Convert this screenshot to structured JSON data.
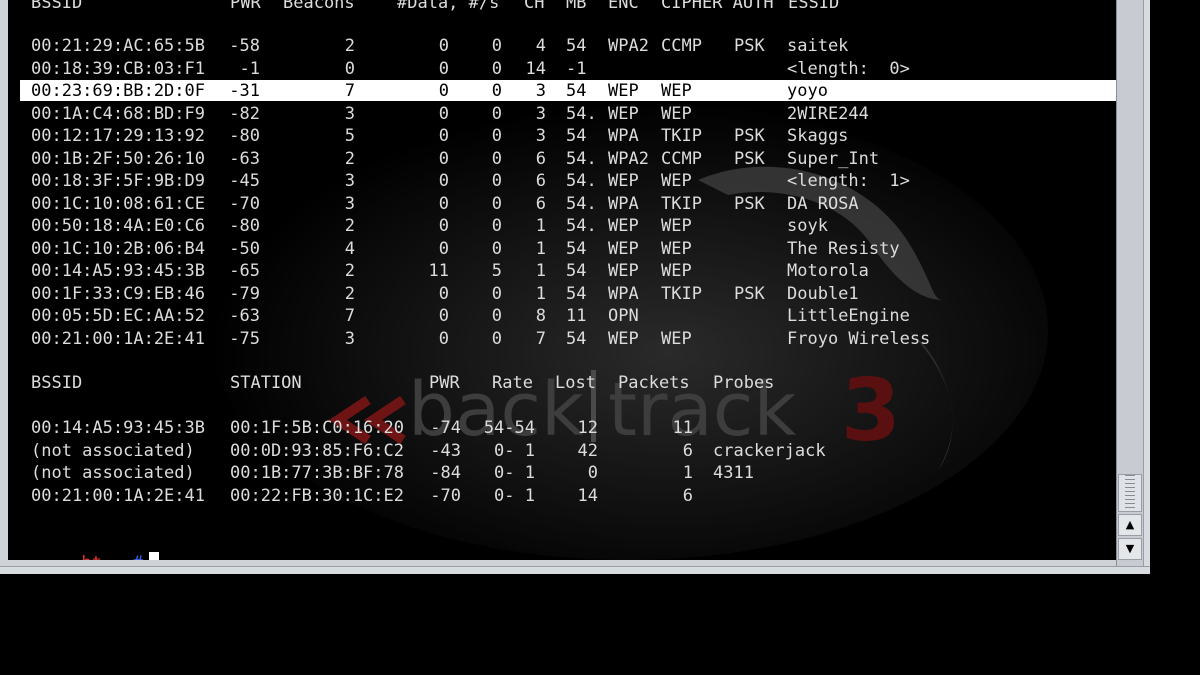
{
  "ap_headers": [
    "BSSID",
    "PWR",
    "Beacons",
    "#Data, #/s",
    "CH",
    "MB",
    "ENC",
    "CIPHER AUTH",
    "ESSID"
  ],
  "ap_rows": [
    {
      "bssid": "00:21:29:AC:65:5B",
      "pwr": "-58",
      "beacons": "2",
      "data": "0",
      "rate": "0",
      "ch": "4",
      "mb": "54",
      "enc": "WPA2",
      "cipher": "CCMP",
      "auth": "PSK",
      "essid": "saitek"
    },
    {
      "bssid": "00:18:39:CB:03:F1",
      "pwr": "-1",
      "beacons": "0",
      "data": "0",
      "rate": "0",
      "ch": "14",
      "mb": "-1",
      "enc": "",
      "cipher": "",
      "auth": "",
      "essid": "<length:  0>"
    },
    {
      "bssid": "00:23:69:BB:2D:0F",
      "pwr": "-31",
      "beacons": "7",
      "data": "0",
      "rate": "0",
      "ch": "3",
      "mb": "54",
      "enc": "WEP",
      "cipher": "WEP",
      "auth": "",
      "essid": "yoyo",
      "selected": true
    },
    {
      "bssid": "00:1A:C4:68:BD:F9",
      "pwr": "-82",
      "beacons": "3",
      "data": "0",
      "rate": "0",
      "ch": "3",
      "mb": "54.",
      "enc": "WEP",
      "cipher": "WEP",
      "auth": "",
      "essid": "2WIRE244"
    },
    {
      "bssid": "00:12:17:29:13:92",
      "pwr": "-80",
      "beacons": "5",
      "data": "0",
      "rate": "0",
      "ch": "3",
      "mb": "54",
      "enc": "WPA",
      "cipher": "TKIP",
      "auth": "PSK",
      "essid": "Skaggs"
    },
    {
      "bssid": "00:1B:2F:50:26:10",
      "pwr": "-63",
      "beacons": "2",
      "data": "0",
      "rate": "0",
      "ch": "6",
      "mb": "54.",
      "enc": "WPA2",
      "cipher": "CCMP",
      "auth": "PSK",
      "essid": "Super_Int"
    },
    {
      "bssid": "00:18:3F:5F:9B:D9",
      "pwr": "-45",
      "beacons": "3",
      "data": "0",
      "rate": "0",
      "ch": "6",
      "mb": "54.",
      "enc": "WEP",
      "cipher": "WEP",
      "auth": "",
      "essid": "<length:  1>"
    },
    {
      "bssid": "00:1C:10:08:61:CE",
      "pwr": "-70",
      "beacons": "3",
      "data": "0",
      "rate": "0",
      "ch": "6",
      "mb": "54.",
      "enc": "WPA",
      "cipher": "TKIP",
      "auth": "PSK",
      "essid": "DA ROSA"
    },
    {
      "bssid": "00:50:18:4A:E0:C6",
      "pwr": "-80",
      "beacons": "2",
      "data": "0",
      "rate": "0",
      "ch": "1",
      "mb": "54.",
      "enc": "WEP",
      "cipher": "WEP",
      "auth": "",
      "essid": "soyk"
    },
    {
      "bssid": "00:1C:10:2B:06:B4",
      "pwr": "-50",
      "beacons": "4",
      "data": "0",
      "rate": "0",
      "ch": "1",
      "mb": "54",
      "enc": "WEP",
      "cipher": "WEP",
      "auth": "",
      "essid": "The Resisty"
    },
    {
      "bssid": "00:14:A5:93:45:3B",
      "pwr": "-65",
      "beacons": "2",
      "data": "11",
      "rate": "5",
      "ch": "1",
      "mb": "54",
      "enc": "WEP",
      "cipher": "WEP",
      "auth": "",
      "essid": "Motorola"
    },
    {
      "bssid": "00:1F:33:C9:EB:46",
      "pwr": "-79",
      "beacons": "2",
      "data": "0",
      "rate": "0",
      "ch": "1",
      "mb": "54",
      "enc": "WPA",
      "cipher": "TKIP",
      "auth": "PSK",
      "essid": "Double1"
    },
    {
      "bssid": "00:05:5D:EC:AA:52",
      "pwr": "-63",
      "beacons": "7",
      "data": "0",
      "rate": "0",
      "ch": "8",
      "mb": "11",
      "enc": "OPN",
      "cipher": "",
      "auth": "",
      "essid": "LittleEngine"
    },
    {
      "bssid": "00:21:00:1A:2E:41",
      "pwr": "-75",
      "beacons": "3",
      "data": "0",
      "rate": "0",
      "ch": "7",
      "mb": "54",
      "enc": "WEP",
      "cipher": "WEP",
      "auth": "",
      "essid": "Froyo Wireless"
    }
  ],
  "st_headers": [
    "BSSID",
    "STATION",
    "PWR",
    "Rate",
    "Lost",
    "Packets",
    "Probes"
  ],
  "st_rows": [
    {
      "bssid": "00:14:A5:93:45:3B",
      "station": "00:1F:5B:C0:16:20",
      "pwr": "-74",
      "rate": "54-54",
      "lost": "12",
      "packets": "11",
      "probes": ""
    },
    {
      "bssid": "(not associated)",
      "station": "00:0D:93:85:F6:C2",
      "pwr": "-43",
      "rate": "0- 1",
      "lost": "42",
      "packets": "6",
      "probes": "crackerjack"
    },
    {
      "bssid": "(not associated)",
      "station": "00:1B:77:3B:BF:78",
      "pwr": "-84",
      "rate": "0- 1",
      "lost": "0",
      "packets": "1",
      "probes": "4311"
    },
    {
      "bssid": "00:21:00:1A:2E:41",
      "station": "00:22:FB:30:1C:E2",
      "pwr": "-70",
      "rate": "0- 1",
      "lost": "14",
      "packets": "6",
      "probes": ""
    }
  ],
  "watermark": {
    "text1": "back",
    "text2": "track",
    "number": "3"
  },
  "prompt": {
    "user": "bt",
    "path": "~",
    "symbol": "#"
  },
  "colors": {
    "prompt_user": "#e03030",
    "prompt_symbol": "#3a6cff",
    "selected_row_bg": "#ffffff"
  }
}
